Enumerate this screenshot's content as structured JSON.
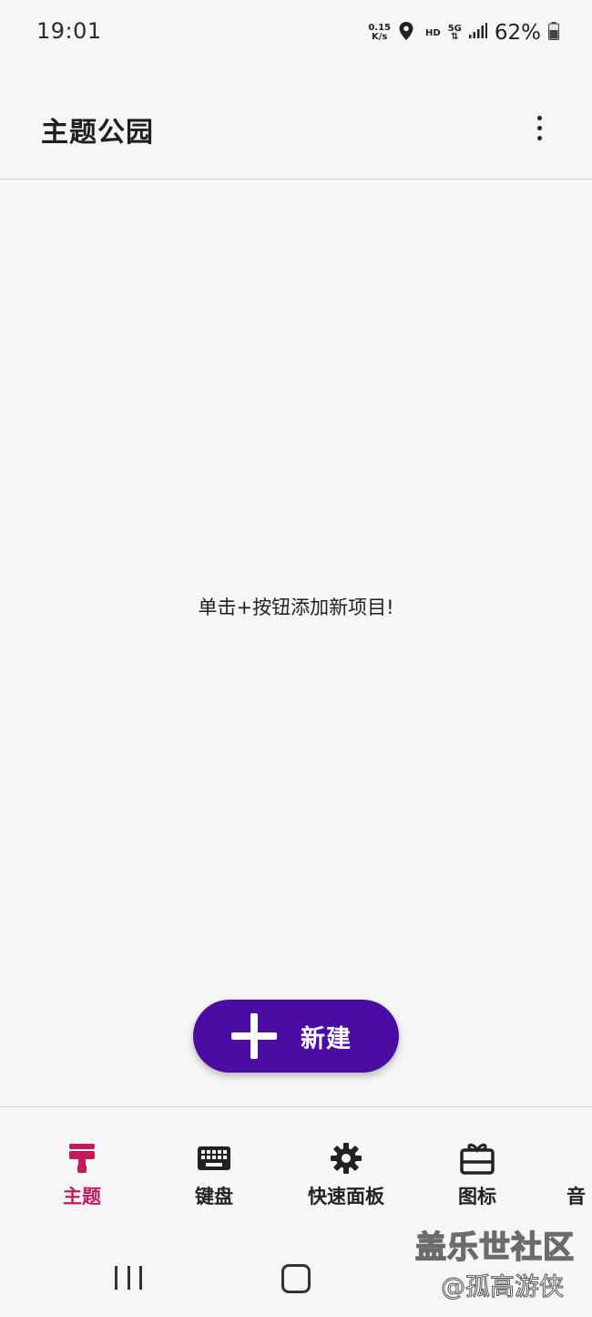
{
  "status_bar": {
    "time": "19:01",
    "net_speed_value": "0.15",
    "net_speed_unit": "K/s",
    "hd": "HD",
    "network": "5G",
    "battery": "62%"
  },
  "app_bar": {
    "title": "主题公园"
  },
  "main": {
    "empty_message": "单击+按钮添加新项目!"
  },
  "fab": {
    "label": "新建"
  },
  "bottom_nav": {
    "items": [
      {
        "label": "主题",
        "icon": "paint-brush-icon",
        "active": true
      },
      {
        "label": "键盘",
        "icon": "keyboard-icon",
        "active": false
      },
      {
        "label": "快速面板",
        "icon": "gear-icon",
        "active": false
      },
      {
        "label": "图标",
        "icon": "gift-card-icon",
        "active": false
      }
    ],
    "partial_label": "音"
  },
  "watermark": {
    "line1": "盖乐世社区",
    "line2": "@孤高游侠"
  },
  "colors": {
    "accent": "#4b0ca1",
    "active_nav": "#c3195d",
    "background": "#f6f6f7"
  }
}
